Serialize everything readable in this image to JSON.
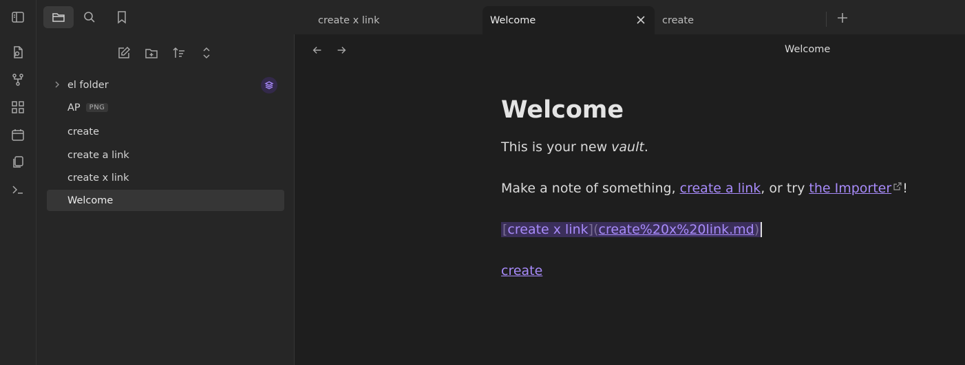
{
  "colors": {
    "accent": "#a88bfa",
    "background": "#1e1e1e",
    "sidebar_bg": "#262626"
  },
  "ribbon": {
    "icons": [
      "sidebar-toggle-icon",
      "open-quick-switcher-icon",
      "graph-view-icon",
      "canvas-icon",
      "daily-note-icon",
      "templates-icon",
      "command-palette-icon"
    ]
  },
  "side_header": {
    "tabs": [
      "files-icon",
      "search-icon",
      "bookmark-icon"
    ]
  },
  "nav_actions": [
    "new-note-icon",
    "new-folder-icon",
    "sort-icon",
    "collapse-all-icon"
  ],
  "file_tree": [
    {
      "label": "el folder",
      "type": "folder"
    },
    {
      "label": "AP",
      "badge": "PNG",
      "type": "file"
    },
    {
      "label": "create",
      "type": "file"
    },
    {
      "label": "create a link",
      "type": "file"
    },
    {
      "label": "create x link",
      "type": "file"
    },
    {
      "label": "Welcome",
      "type": "file",
      "active": true
    }
  ],
  "tabs": [
    {
      "label": "create x link"
    },
    {
      "label": "Welcome",
      "active": true
    },
    {
      "label": "create"
    }
  ],
  "view": {
    "title": "Welcome"
  },
  "note": {
    "heading": "Welcome",
    "line1_pre": "This is your new ",
    "line1_em": "vault",
    "line1_post": ".",
    "line2_pre": "Make a note of something, ",
    "line2_link1": "create a link",
    "line2_mid": ", or try ",
    "line2_link2": "the Importer",
    "line2_post": "!",
    "raw_link_text": "create x link",
    "raw_link_target": "create%20x%20link.md",
    "bottom_link": "create"
  }
}
